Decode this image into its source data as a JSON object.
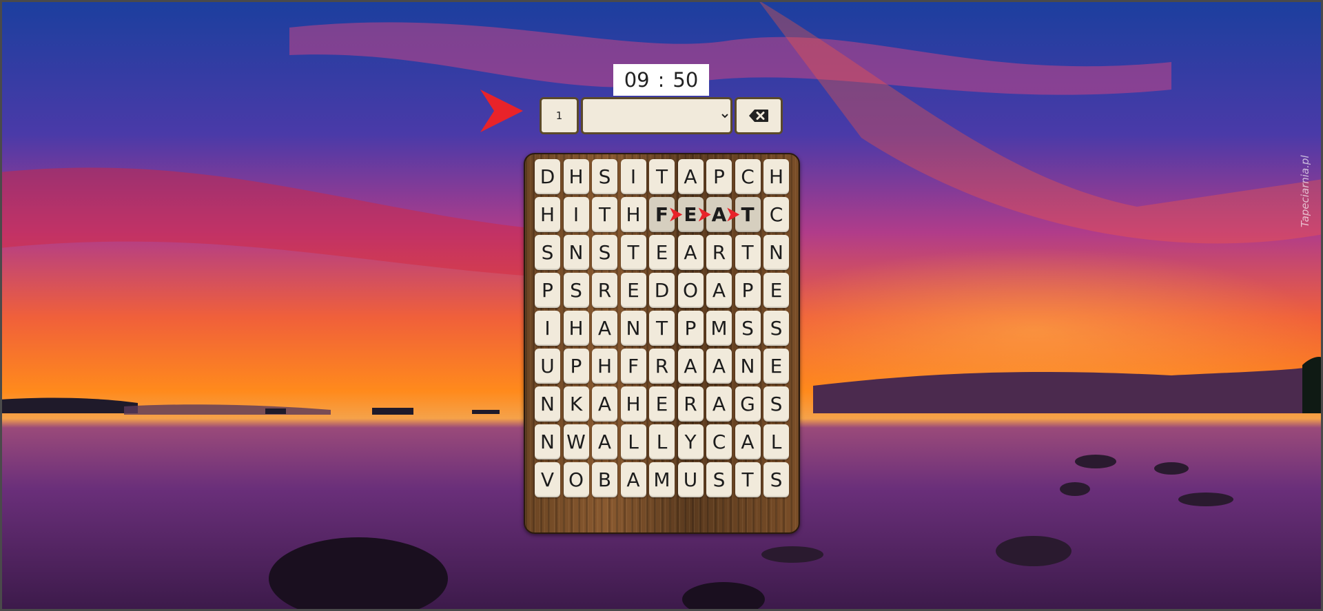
{
  "timer": {
    "minutes": "09",
    "separator": ":",
    "seconds": "50"
  },
  "controls": {
    "word_count": "1",
    "word_select_value": "",
    "delete_icon": "backspace-icon"
  },
  "board": {
    "rows": [
      [
        "D",
        "H",
        "S",
        "I",
        "T",
        "A",
        "P",
        "C",
        "H"
      ],
      [
        "H",
        "I",
        "T",
        "H",
        "F",
        "E",
        "A",
        "T",
        "C"
      ],
      [
        "S",
        "N",
        "S",
        "T",
        "E",
        "A",
        "R",
        "T",
        "N"
      ],
      [
        "P",
        "S",
        "R",
        "E",
        "D",
        "O",
        "A",
        "P",
        "E"
      ],
      [
        "I",
        "H",
        "A",
        "N",
        "T",
        "P",
        "M",
        "S",
        "S"
      ],
      [
        "U",
        "P",
        "H",
        "F",
        "R",
        "A",
        "A",
        "N",
        "E"
      ],
      [
        "N",
        "K",
        "A",
        "H",
        "E",
        "R",
        "A",
        "G",
        "S"
      ],
      [
        "N",
        "W",
        "A",
        "L",
        "L",
        "Y",
        "C",
        "A",
        "L"
      ],
      [
        "V",
        "O",
        "B",
        "A",
        "M",
        "U",
        "S",
        "T",
        "S"
      ]
    ],
    "selected_path": [
      [
        1,
        4
      ],
      [
        1,
        5
      ],
      [
        1,
        6
      ],
      [
        1,
        7
      ]
    ],
    "current_word": "FEAT"
  },
  "watermark": "Tapeciarnia.pl",
  "colors": {
    "tile": "#f1eadb",
    "tile_selected": "#d6cfbf",
    "arrow": "#e8232a",
    "board_wood": "#7a4e28"
  }
}
